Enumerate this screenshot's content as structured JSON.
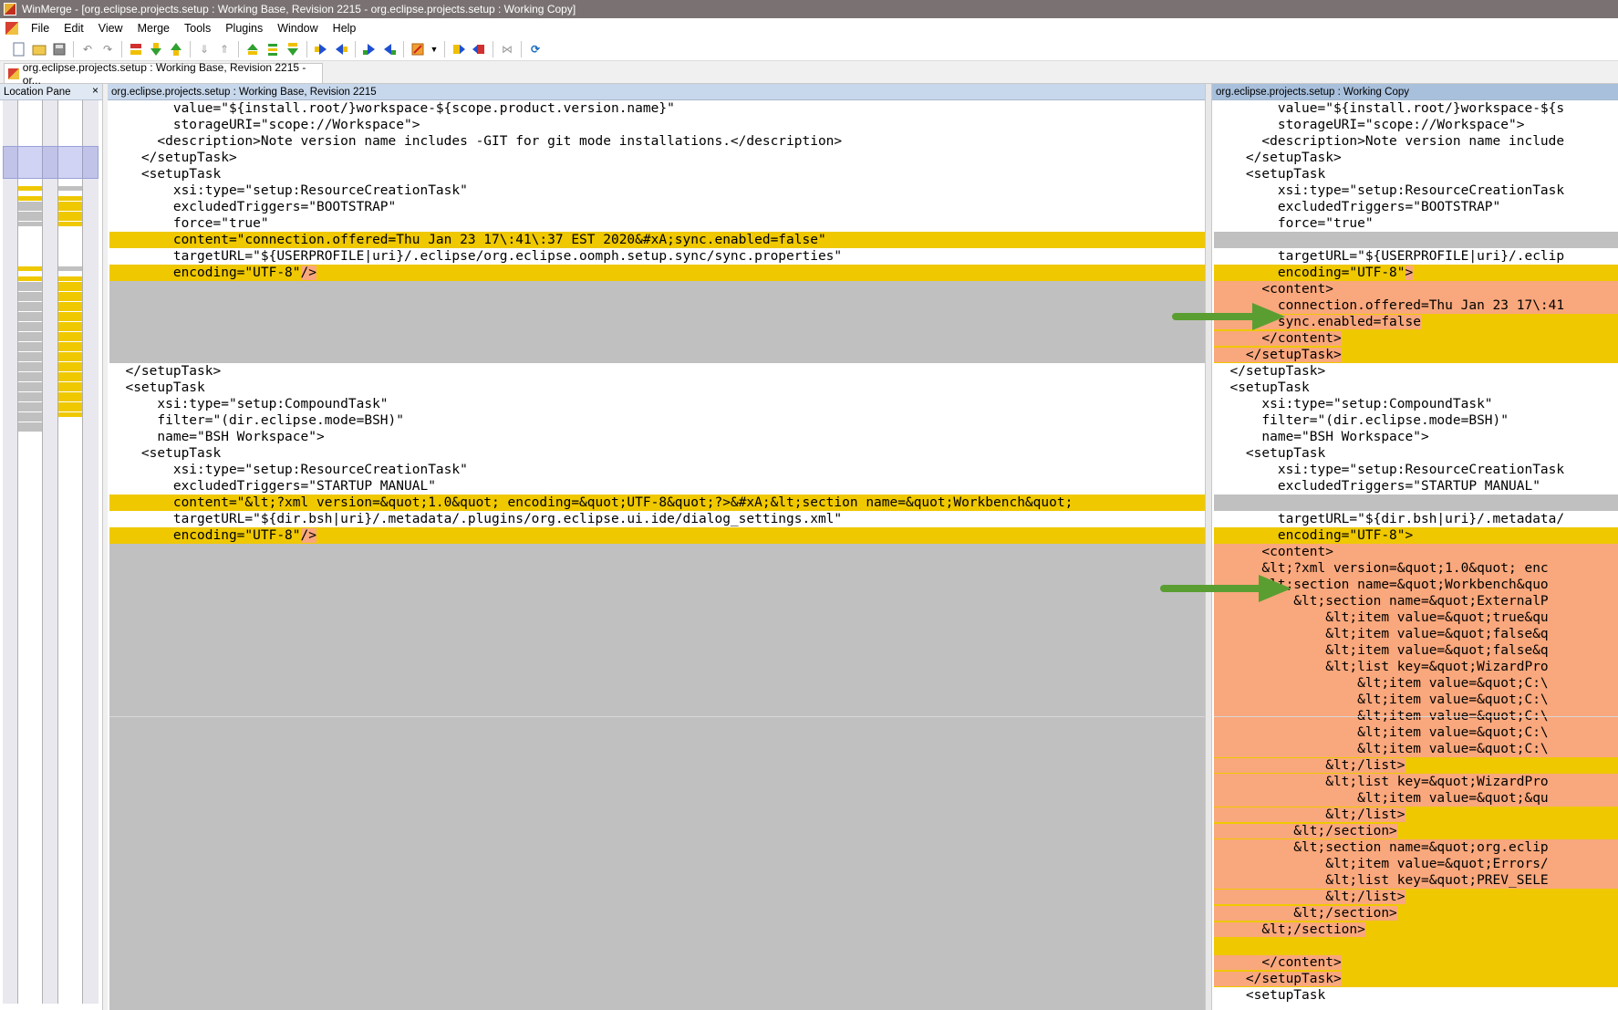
{
  "window": {
    "title": "WinMerge - [org.eclipse.projects.setup : Working Base, Revision 2215 - org.eclipse.projects.setup : Working Copy]"
  },
  "menu": [
    "File",
    "Edit",
    "View",
    "Merge",
    "Tools",
    "Plugins",
    "Window",
    "Help"
  ],
  "toolbar": {
    "icons": [
      "new-icon",
      "open-icon",
      "save-icon",
      "undo-icon",
      "redo-icon",
      "first-diff-icon",
      "next-diff-icon",
      "prev-diff-icon",
      "prev-conflict-icon",
      "next-conflict-icon",
      "all-left-icon",
      "all-right-icon",
      "copy-left-icon",
      "copy-right-icon",
      "copy-right-advance-icon",
      "copy-left-advance-icon",
      "options-icon",
      "dropdown-icon",
      "next-file-icon",
      "prev-file-icon",
      "collapse-icon",
      "refresh-icon"
    ]
  },
  "document_tab": {
    "label": "org.eclipse.projects.setup : Working Base, Revision 2215 - or..."
  },
  "location_pane": {
    "title": "Location Pane",
    "close": "×"
  },
  "left_pane": {
    "header": "org.eclipse.projects.setup : Working Base, Revision 2215",
    "lines": [
      {
        "t": "        value=\"${install.root/}workspace-${scope.product.version.name}\"",
        "s": "n"
      },
      {
        "t": "        storageURI=\"scope://Workspace\">",
        "s": "n"
      },
      {
        "t": "      <description>Note version name includes -GIT for git mode installations.</description>",
        "s": "n"
      },
      {
        "t": "    </setupTask>",
        "s": "n"
      },
      {
        "t": "    <setupTask",
        "s": "n"
      },
      {
        "t": "        xsi:type=\"setup:ResourceCreationTask\"",
        "s": "n"
      },
      {
        "t": "        excludedTriggers=\"BOOTSTRAP\"",
        "s": "n"
      },
      {
        "t": "        force=\"true\"",
        "s": "n"
      },
      {
        "t": "        content=\"connection.offered=Thu Jan 23 17\\:41\\:37 EST 2020&#xA;sync.enabled=false\"",
        "s": "d"
      },
      {
        "t": "        targetURL=\"${USERPROFILE|uri}/.eclipse/org.eclipse.oomph.setup.sync/sync.properties\"",
        "s": "n"
      },
      {
        "t": "        encoding=\"UTF-8\"",
        "s": "d",
        "h": "/>"
      },
      {
        "t": "",
        "s": "b"
      },
      {
        "t": "",
        "s": "b"
      },
      {
        "t": "",
        "s": "b"
      },
      {
        "t": "",
        "s": "b"
      },
      {
        "t": "",
        "s": "b"
      },
      {
        "t": "  </setupTask>",
        "s": "n"
      },
      {
        "t": "  <setupTask",
        "s": "n"
      },
      {
        "t": "      xsi:type=\"setup:CompoundTask\"",
        "s": "n"
      },
      {
        "t": "      filter=\"(dir.eclipse.mode=BSH)\"",
        "s": "n"
      },
      {
        "t": "      name=\"BSH Workspace\">",
        "s": "n"
      },
      {
        "t": "    <setupTask",
        "s": "n"
      },
      {
        "t": "        xsi:type=\"setup:ResourceCreationTask\"",
        "s": "n"
      },
      {
        "t": "        excludedTriggers=\"STARTUP MANUAL\"",
        "s": "n"
      },
      {
        "t": "        content=\"&lt;?xml version=&quot;1.0&quot; encoding=&quot;UTF-8&quot;?>&#xA;&lt;section name=&quot;Workbench&quot;",
        "s": "d"
      },
      {
        "t": "        targetURL=\"${dir.bsh|uri}/.metadata/.plugins/org.eclipse.ui.ide/dialog_settings.xml\"",
        "s": "n"
      },
      {
        "t": "        encoding=\"UTF-8\"",
        "s": "d",
        "h": "/>"
      },
      {
        "t": "",
        "s": "b"
      },
      {
        "t": "",
        "s": "b"
      },
      {
        "t": "",
        "s": "b"
      },
      {
        "t": "",
        "s": "b"
      },
      {
        "t": "",
        "s": "b"
      },
      {
        "t": "",
        "s": "b"
      },
      {
        "t": "",
        "s": "b"
      },
      {
        "t": "",
        "s": "b"
      },
      {
        "t": "",
        "s": "b"
      },
      {
        "t": "",
        "s": "b"
      },
      {
        "t": "",
        "s": "b"
      },
      {
        "t": "",
        "s": "b"
      },
      {
        "t": "",
        "s": "b"
      },
      {
        "t": "",
        "s": "b"
      },
      {
        "t": "",
        "s": "b"
      },
      {
        "t": "",
        "s": "b"
      },
      {
        "t": "",
        "s": "b"
      },
      {
        "t": "",
        "s": "b"
      },
      {
        "t": "",
        "s": "b"
      },
      {
        "t": "",
        "s": "b"
      },
      {
        "t": "",
        "s": "b"
      },
      {
        "t": "",
        "s": "b"
      },
      {
        "t": "",
        "s": "b"
      },
      {
        "t": "",
        "s": "b"
      },
      {
        "t": "",
        "s": "b"
      },
      {
        "t": "",
        "s": "b"
      },
      {
        "t": "",
        "s": "b"
      },
      {
        "t": "",
        "s": "b"
      },
      {
        "t": "",
        "s": "b"
      },
      {
        "t": "",
        "s": "b"
      },
      {
        "t": "    <setupTask",
        "s": "n"
      }
    ]
  },
  "right_pane": {
    "header": "org.eclipse.projects.setup : Working Copy",
    "lines": [
      {
        "t": "        value=\"${install.root/}workspace-${s",
        "s": "n"
      },
      {
        "t": "        storageURI=\"scope://Workspace\">",
        "s": "n"
      },
      {
        "t": "      <description>Note version name include",
        "s": "n"
      },
      {
        "t": "    </setupTask>",
        "s": "n"
      },
      {
        "t": "    <setupTask",
        "s": "n"
      },
      {
        "t": "        xsi:type=\"setup:ResourceCreationTask",
        "s": "n"
      },
      {
        "t": "        excludedTriggers=\"BOOTSTRAP\"",
        "s": "n"
      },
      {
        "t": "        force=\"true\"",
        "s": "n"
      },
      {
        "t": "",
        "s": "b"
      },
      {
        "t": "        targetURL=\"${USERPROFILE|uri}/.eclip",
        "s": "n"
      },
      {
        "t": "        encoding=\"UTF-8\"",
        "s": "d",
        "h": ">"
      },
      {
        "t": "      <content>",
        "s": "m"
      },
      {
        "t": "        connection.offered=Thu Jan 23 17\\:41",
        "s": "m"
      },
      {
        "t": "        sync.enabled=false",
        "s": "d",
        "hl": true
      },
      {
        "t": "      </content>",
        "s": "d",
        "hl": true
      },
      {
        "t": "    </setupTask>",
        "s": "d",
        "hl": true
      },
      {
        "t": "  </setupTask>",
        "s": "n"
      },
      {
        "t": "  <setupTask",
        "s": "n"
      },
      {
        "t": "      xsi:type=\"setup:CompoundTask\"",
        "s": "n"
      },
      {
        "t": "      filter=\"(dir.eclipse.mode=BSH)\"",
        "s": "n"
      },
      {
        "t": "      name=\"BSH Workspace\">",
        "s": "n"
      },
      {
        "t": "    <setupTask",
        "s": "n"
      },
      {
        "t": "        xsi:type=\"setup:ResourceCreationTask",
        "s": "n"
      },
      {
        "t": "        excludedTriggers=\"STARTUP MANUAL\"",
        "s": "n"
      },
      {
        "t": "",
        "s": "b"
      },
      {
        "t": "        targetURL=\"${dir.bsh|uri}/.metadata/",
        "s": "n"
      },
      {
        "t": "        encoding=\"UTF-8\">",
        "s": "d"
      },
      {
        "t": "      <content>",
        "s": "m"
      },
      {
        "t": "      &lt;?xml version=&quot;1.0&quot; enc",
        "s": "m"
      },
      {
        "t": "      &lt;section name=&quot;Workbench&quo",
        "s": "m"
      },
      {
        "t": "          &lt;section name=&quot;ExternalP",
        "s": "m"
      },
      {
        "t": "              &lt;item value=&quot;true&qu",
        "s": "m"
      },
      {
        "t": "              &lt;item value=&quot;false&q",
        "s": "m"
      },
      {
        "t": "              &lt;item value=&quot;false&q",
        "s": "m"
      },
      {
        "t": "              &lt;list key=&quot;WizardPro",
        "s": "m"
      },
      {
        "t": "                  &lt;item value=&quot;C:\\",
        "s": "m"
      },
      {
        "t": "                  &lt;item value=&quot;C:\\",
        "s": "m"
      },
      {
        "t": "                  &lt;item value=&quot;C:\\",
        "s": "m"
      },
      {
        "t": "                  &lt;item value=&quot;C:\\",
        "s": "m"
      },
      {
        "t": "                  &lt;item value=&quot;C:\\",
        "s": "m"
      },
      {
        "t": "              &lt;/list>",
        "s": "d",
        "hl": true
      },
      {
        "t": "              &lt;list key=&quot;WizardPro",
        "s": "m"
      },
      {
        "t": "                  &lt;item value=&quot;&qu",
        "s": "m"
      },
      {
        "t": "              &lt;/list>",
        "s": "d",
        "hl": true
      },
      {
        "t": "          &lt;/section>",
        "s": "d",
        "hl": true
      },
      {
        "t": "          &lt;section name=&quot;org.eclip",
        "s": "m"
      },
      {
        "t": "              &lt;item value=&quot;Errors/",
        "s": "m"
      },
      {
        "t": "              &lt;list key=&quot;PREV_SELE",
        "s": "m"
      },
      {
        "t": "              &lt;/list>",
        "s": "d",
        "hl": true
      },
      {
        "t": "          &lt;/section>",
        "s": "d",
        "hl": true
      },
      {
        "t": "      &lt;/section>",
        "s": "d",
        "hl": true
      },
      {
        "t": "",
        "s": "d"
      },
      {
        "t": "      </content>",
        "s": "d",
        "hl": true
      },
      {
        "t": "    </setupTask>",
        "s": "d",
        "hl": true
      },
      {
        "t": "    <setupTask",
        "s": "n"
      }
    ]
  },
  "colors": {
    "diff": "#efc800",
    "blank": "#c0c0c0",
    "moved": "#f9a77c",
    "arrow": "#5a9e32"
  }
}
